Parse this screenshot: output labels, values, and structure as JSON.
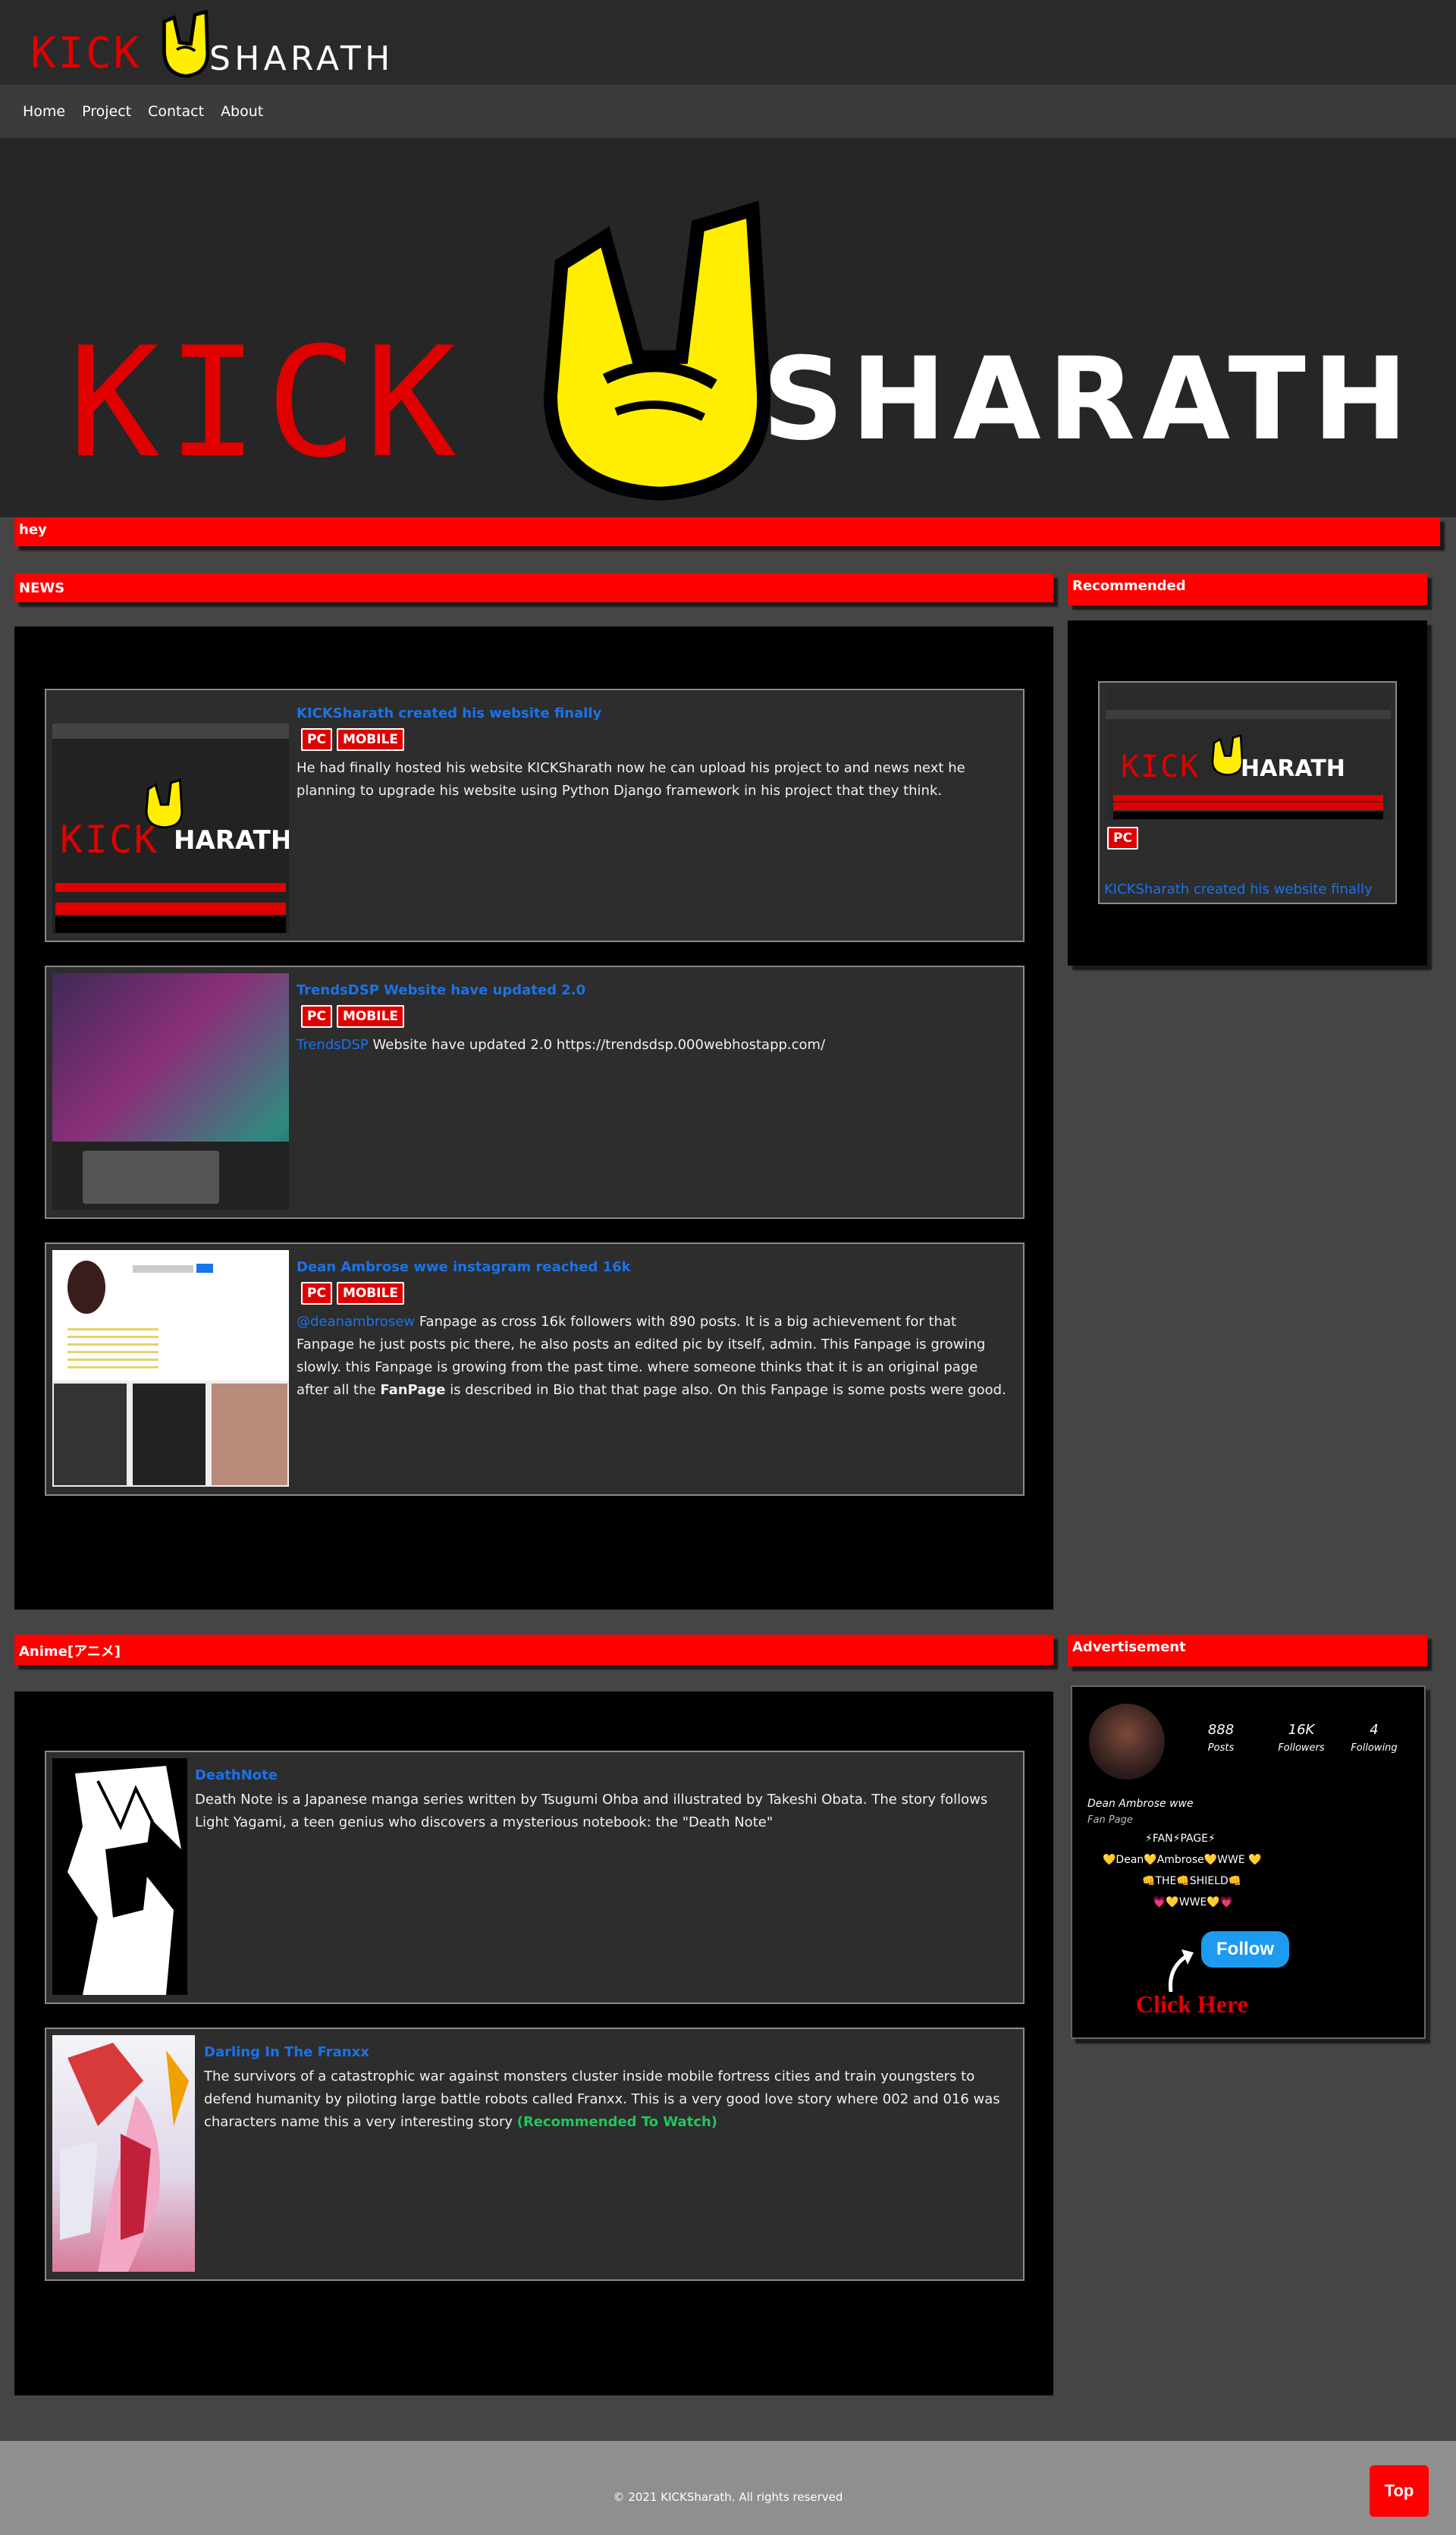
{
  "header": {
    "logo_kick": "KICK",
    "logo_sharath": "SHARATH"
  },
  "nav": {
    "items": [
      "Home",
      "Project",
      "Contact",
      "About"
    ]
  },
  "hero": {
    "logo_kick": "KICK",
    "logo_sharath": "SHARATH"
  },
  "announce": {
    "label": "hey"
  },
  "news": {
    "header": "NEWS",
    "posts": [
      {
        "title": "KICKSharath created his website finally",
        "badges": [
          "PC",
          "MOBILE"
        ],
        "text": "He had finally hosted his website KICKSharath now he can upload his project to and news next he planning to upgrade his website using Python Django framework in his project that they think."
      },
      {
        "title": "TrendsDSP Website have updated 2.0",
        "badges": [
          "PC",
          "MOBILE"
        ],
        "link": "TrendsDSP",
        "text": " Website have updated 2.0 https://trendsdsp.000webhostapp.com/"
      },
      {
        "title": "Dean Ambrose wwe instagram reached 16k",
        "badges": [
          "PC",
          "MOBILE"
        ],
        "link": "@deanambrosew",
        "text_a": " Fanpage as cross 16k followers with 890 posts. It is a big achievement for that Fanpage he just posts pic there, he also posts an edited pic by itself, admin. This Fanpage is growing slowly. this Fanpage is growing from the past time. where someone thinks that it is an original page after all the ",
        "bold": "FanPage",
        "text_b": " is described in Bio that that page also. On this Fanpage is some posts were good."
      }
    ]
  },
  "recommended": {
    "header": "Recommended",
    "badge": "PC",
    "title": "KICKSharath created his website finally"
  },
  "anime": {
    "header": "Anime[アニメ]",
    "posts": [
      {
        "title": "DeathNote",
        "text": "Death Note is a Japanese manga series written by Tsugumi Ohba and illustrated by Takeshi Obata. The story follows Light Yagami, a teen genius who discovers a mysterious notebook: the \"Death Note\""
      },
      {
        "title": "Darling In The Franxx",
        "text": "The survivors of a catastrophic war against monsters cluster inside mobile fortress cities and train youngsters to defend humanity by piloting large battle robots called Franxx. This is a very good love story where 002 and 016 was characters name this a very interesting story ",
        "highlight": "(Recommended To Watch)"
      }
    ]
  },
  "advertisement": {
    "header": "Advertisement",
    "posts_count": "888",
    "posts_label": "Posts",
    "followers_count": "16K",
    "followers_label": "Followers",
    "following_count": "4",
    "following_label": "Following",
    "name": "Dean Ambrose wwe",
    "category": "Fan Page",
    "bio1": "⚡FAN⚡PAGE⚡",
    "bio2": "💛Dean💛Ambrose💛WWE 💛",
    "bio3": "👊THE👊SHIELD👊",
    "bio4": "💗💛WWE💛💗",
    "follow": "Follow",
    "click": "Click Here"
  },
  "footer": {
    "copyright": "© 2021 KICKSharath. All rights reserved",
    "top_button": "Top"
  },
  "colors": {
    "accent_red": "#ff0000",
    "link_blue": "#1a73e8",
    "highlight_green": "#22c55e",
    "logo_yellow": "#ffee00"
  }
}
